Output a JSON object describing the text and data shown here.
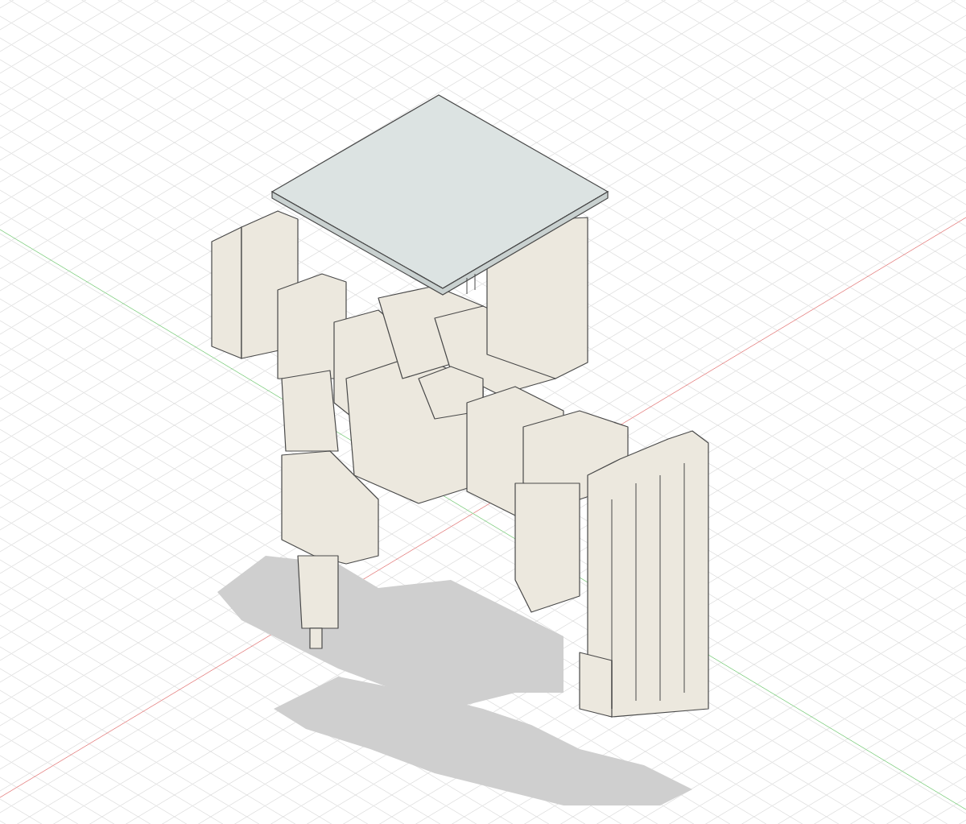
{
  "viewport": {
    "grid": true,
    "axes": true,
    "shadows": true
  }
}
